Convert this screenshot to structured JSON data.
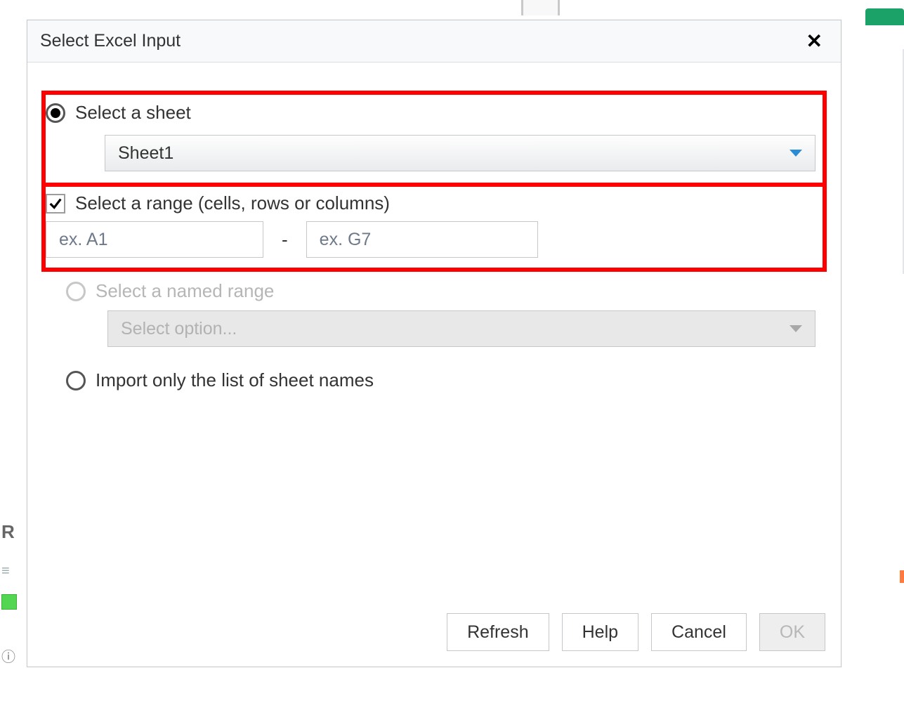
{
  "background": {
    "left_R": "R"
  },
  "dialog": {
    "title": "Select Excel Input"
  },
  "options": {
    "select_sheet": {
      "label": "Select a sheet",
      "selected": true,
      "sheet_dropdown_value": "Sheet1",
      "range_checkbox": {
        "label": "Select a range (cells, rows or columns)",
        "checked": true,
        "from_placeholder": "ex. A1",
        "to_placeholder": "ex. G7",
        "from_value": "",
        "to_value": ""
      }
    },
    "named_range": {
      "label": "Select a named range",
      "selected": false,
      "disabled": true,
      "dropdown_placeholder": "Select option..."
    },
    "import_list": {
      "label": "Import only the list of sheet names",
      "selected": false
    }
  },
  "buttons": {
    "refresh": "Refresh",
    "help": "Help",
    "cancel": "Cancel",
    "ok": "OK",
    "ok_disabled": true
  }
}
